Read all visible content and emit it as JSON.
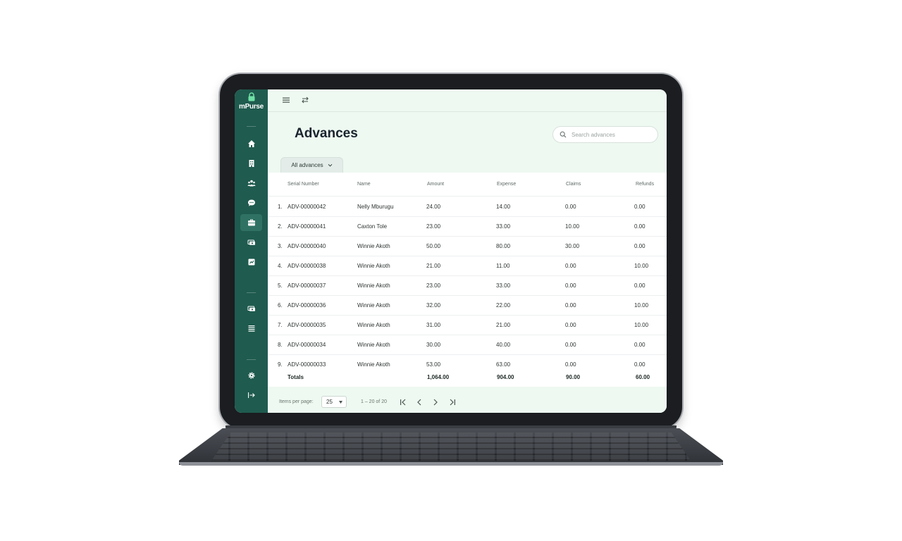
{
  "app": {
    "logo_text": "mPurse"
  },
  "sidebar": {
    "items": [
      {
        "icon": "home-icon"
      },
      {
        "icon": "building-icon"
      },
      {
        "icon": "team-icon"
      },
      {
        "icon": "chat-icon"
      },
      {
        "icon": "briefcase-icon",
        "active": true
      },
      {
        "icon": "cash-icon"
      },
      {
        "icon": "report-icon"
      },
      {
        "icon": "cash-icon"
      },
      {
        "icon": "list-icon"
      },
      {
        "icon": "settings-icon"
      },
      {
        "icon": "logout-icon"
      }
    ]
  },
  "topbar": {
    "menu_icon": "hamburger-icon",
    "switch_icon": "switch-arrows-icon"
  },
  "page": {
    "title": "Advances",
    "search_placeholder": "Search advances",
    "filter_label": "All advances"
  },
  "table": {
    "columns": [
      "Serial Number",
      "Name",
      "Amount",
      "Expense",
      "Claims",
      "Refunds"
    ],
    "rows": [
      {
        "num": "1.",
        "serial": "ADV-00000042",
        "name": "Nelly Mburugu",
        "amount": "24.00",
        "expense": "14.00",
        "claims": "0.00",
        "refunds": "0.00"
      },
      {
        "num": "2.",
        "serial": "ADV-00000041",
        "name": "Caxton Tole",
        "amount": "23.00",
        "expense": "33.00",
        "claims": "10.00",
        "refunds": "0.00"
      },
      {
        "num": "3.",
        "serial": "ADV-00000040",
        "name": "Winnie Akoth",
        "amount": "50.00",
        "expense": "80.00",
        "claims": "30.00",
        "refunds": "0.00"
      },
      {
        "num": "4.",
        "serial": "ADV-00000038",
        "name": "Winnie Akoth",
        "amount": "21.00",
        "expense": "11.00",
        "claims": "0.00",
        "refunds": "10.00"
      },
      {
        "num": "5.",
        "serial": "ADV-00000037",
        "name": "Winnie Akoth",
        "amount": "23.00",
        "expense": "33.00",
        "claims": "0.00",
        "refunds": "0.00"
      },
      {
        "num": "6.",
        "serial": "ADV-00000036",
        "name": "Winnie Akoth",
        "amount": "32.00",
        "expense": "22.00",
        "claims": "0.00",
        "refunds": "10.00"
      },
      {
        "num": "7.",
        "serial": "ADV-00000035",
        "name": "Winnie Akoth",
        "amount": "31.00",
        "expense": "21.00",
        "claims": "0.00",
        "refunds": "10.00"
      },
      {
        "num": "8.",
        "serial": "ADV-00000034",
        "name": "Winnie Akoth",
        "amount": "30.00",
        "expense": "40.00",
        "claims": "0.00",
        "refunds": "0.00"
      },
      {
        "num": "9.",
        "serial": "ADV-00000033",
        "name": "Winnie Akoth",
        "amount": "53.00",
        "expense": "63.00",
        "claims": "0.00",
        "refunds": "0.00"
      }
    ],
    "totals": {
      "label": "Totals",
      "amount": "1,064.00",
      "expense": "904.00",
      "claims": "90.00",
      "refunds": "60.00"
    }
  },
  "pagination": {
    "items_label": "Items per page:",
    "page_size": "25",
    "range": "1 – 20 of 20"
  },
  "colors": {
    "sidebar": "#1f5b4f",
    "background": "#eef9f1",
    "text": "#19232e"
  }
}
